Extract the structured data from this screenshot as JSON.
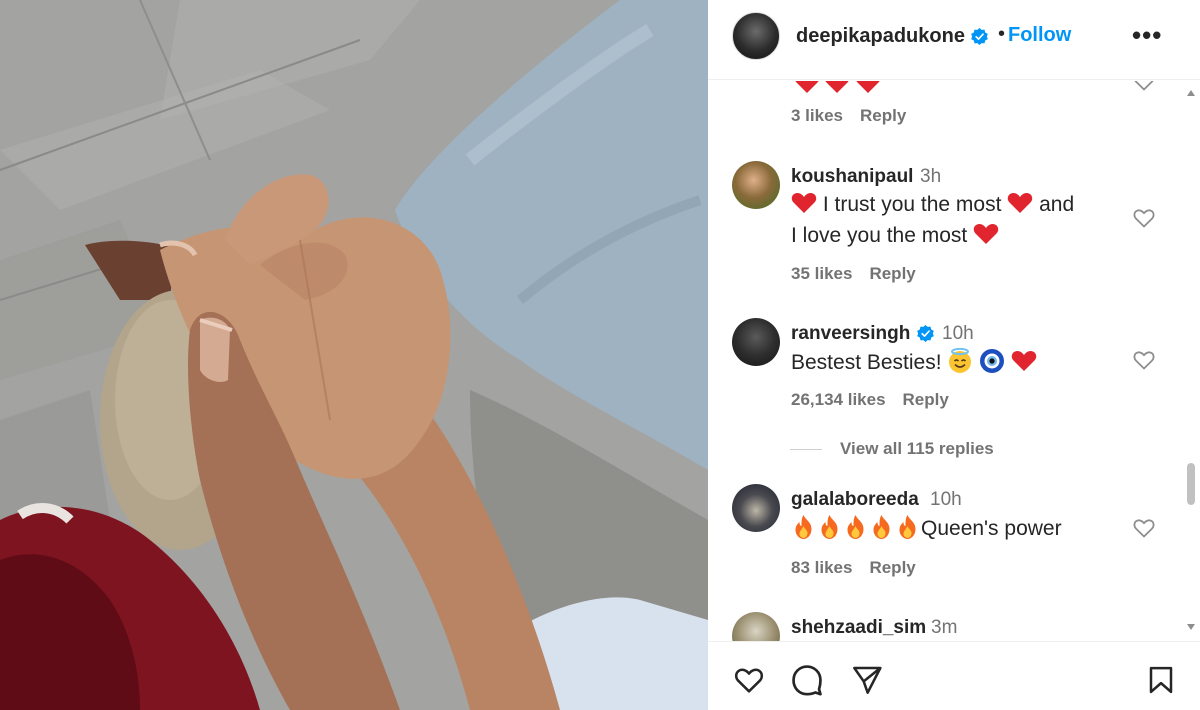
{
  "post": {
    "username": "deepikapadukone",
    "verified": true,
    "follow_label": "Follow",
    "more_icon": "more-horizontal-icon"
  },
  "comments": [
    {
      "user": "",
      "time": "",
      "text": "",
      "likes": "3 likes",
      "reply": "Reply",
      "partial": true
    },
    {
      "user": "koushanipaul",
      "time": "3h",
      "text_a": "I trust you the most",
      "text_b": "and",
      "text_c": "I love you the most",
      "likes": "35 likes",
      "reply": "Reply"
    },
    {
      "user": "ranveersingh",
      "verified": true,
      "time": "10h",
      "text": "Bestest Besties!",
      "likes": "26,134 likes",
      "reply": "Reply"
    },
    {
      "user": "galalaboreeda",
      "time": "10h",
      "text": "Queen's power",
      "likes": "83 likes",
      "reply": "Reply"
    },
    {
      "user": "shehzaadi_sim",
      "time": "3m"
    }
  ],
  "view_replies": "View all 115 replies",
  "icons": {
    "like": "heart-outline-icon",
    "comment": "comment-bubble-icon",
    "share": "paper-plane-icon",
    "save": "bookmark-icon"
  },
  "colors": {
    "accent": "#0095f6",
    "verified": "#0095f6",
    "heart_emoji": "#e0252f",
    "text": "#262626",
    "muted": "#737373"
  }
}
